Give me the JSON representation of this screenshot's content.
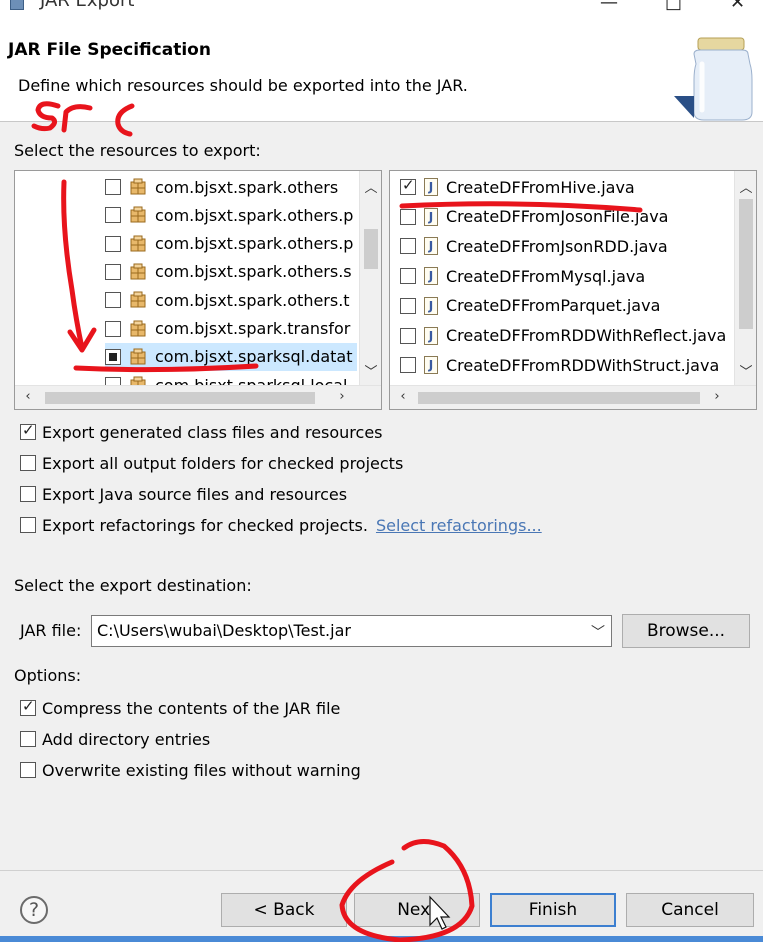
{
  "window": {
    "title": "JAR Export",
    "minimize": "—",
    "maximize": "□",
    "close": "✕"
  },
  "header": {
    "title": "JAR File Specification",
    "description": "Define which resources should be exported into the JAR."
  },
  "resources_label": "Select the resources to export:",
  "left_tree": {
    "items": [
      {
        "label": "com.bjsxt.spark.others",
        "state": "unchecked"
      },
      {
        "label": "com.bjsxt.spark.others.p",
        "state": "unchecked"
      },
      {
        "label": "com.bjsxt.spark.others.p",
        "state": "unchecked"
      },
      {
        "label": "com.bjsxt.spark.others.s",
        "state": "unchecked"
      },
      {
        "label": "com.bjsxt.spark.others.t",
        "state": "unchecked"
      },
      {
        "label": "com.bjsxt.spark.transfor",
        "state": "unchecked"
      },
      {
        "label": "com.bjsxt.sparksql.datat",
        "state": "partial",
        "selected": true
      },
      {
        "label": "com.bjsxt.sparksql.local",
        "state": "unchecked"
      }
    ]
  },
  "right_list": {
    "items": [
      {
        "label": "CreateDFFromHive.java",
        "state": "checked"
      },
      {
        "label": "CreateDFFromJosonFile.java",
        "state": "unchecked"
      },
      {
        "label": "CreateDFFromJsonRDD.java",
        "state": "unchecked"
      },
      {
        "label": "CreateDFFromMysql.java",
        "state": "unchecked"
      },
      {
        "label": "CreateDFFromParquet.java",
        "state": "unchecked"
      },
      {
        "label": "CreateDFFromRDDWithReflect.java",
        "state": "unchecked"
      },
      {
        "label": "CreateDFFromRDDWithStruct.java",
        "state": "unchecked"
      }
    ]
  },
  "export_options": [
    {
      "label": "Export generated class files and resources",
      "checked": true
    },
    {
      "label": "Export all output folders for checked projects",
      "checked": false
    },
    {
      "label": "Export Java source files and resources",
      "checked": false
    },
    {
      "label": "Export refactorings for checked projects.",
      "checked": false,
      "link": "Select refactorings..."
    }
  ],
  "destination": {
    "label": "Select the export destination:",
    "jar_label": "JAR file:",
    "jar_value": "C:\\Users\\wubai\\Desktop\\Test.jar",
    "browse": "Browse..."
  },
  "options": {
    "label": "Options:",
    "items": [
      {
        "label": "Compress the contents of the JAR file",
        "checked": true
      },
      {
        "label": "Add directory entries",
        "checked": false
      },
      {
        "label": "Overwrite existing files without warning",
        "checked": false
      }
    ]
  },
  "buttons": {
    "help": "?",
    "back": "< Back",
    "next": "Next",
    "finish": "Finish",
    "cancel": "Cancel"
  },
  "annotation_text": "src",
  "colors": {
    "annotation": "#e8141c",
    "selection": "#cce8ff",
    "accent": "#3c7fd0"
  }
}
